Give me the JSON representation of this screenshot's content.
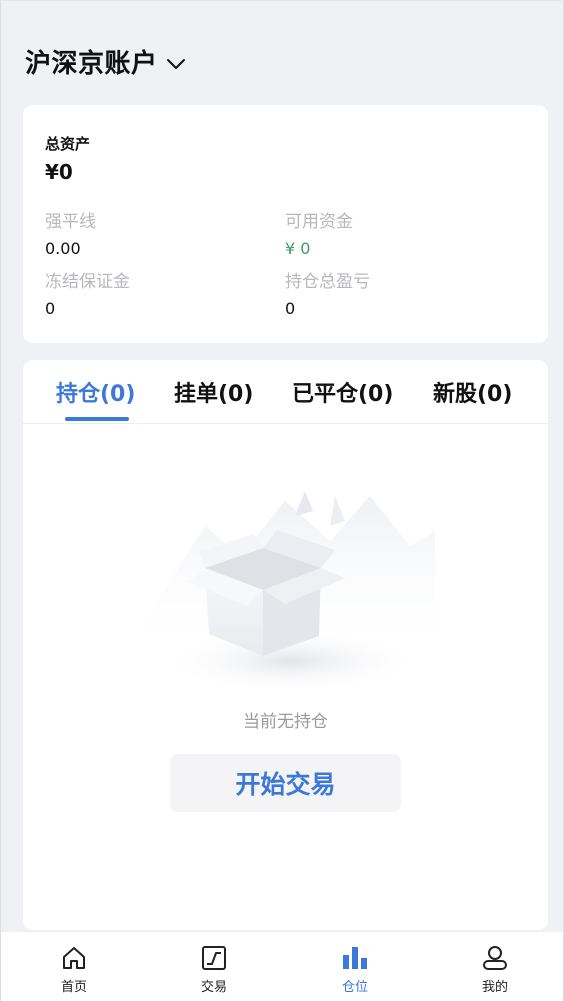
{
  "header": {
    "title": "沪深京账户"
  },
  "assets": {
    "total_label": "总资产",
    "total_value": "¥0",
    "stats": [
      {
        "label": "强平线",
        "value": "0.00"
      },
      {
        "label": "可用资金",
        "value": "¥ 0"
      },
      {
        "label": "冻结保证金",
        "value": "0"
      },
      {
        "label": "持仓总盈亏",
        "value": "0"
      }
    ]
  },
  "tabs": [
    {
      "label": "持仓(0)",
      "active": true
    },
    {
      "label": "挂单(0)",
      "active": false
    },
    {
      "label": "已平仓(0)",
      "active": false
    },
    {
      "label": "新股(0)",
      "active": false
    }
  ],
  "empty": {
    "text": "当前无持仓",
    "button": "开始交易"
  },
  "nav": [
    {
      "label": "首页",
      "icon": "home-icon"
    },
    {
      "label": "交易",
      "icon": "trade-chart-icon"
    },
    {
      "label": "仓位",
      "icon": "position-bars-icon",
      "active": true
    },
    {
      "label": "我的",
      "icon": "user-icon"
    }
  ],
  "colors": {
    "accent": "#3b78d8",
    "green": "#3e9a5e",
    "background": "#f0f1f5"
  }
}
